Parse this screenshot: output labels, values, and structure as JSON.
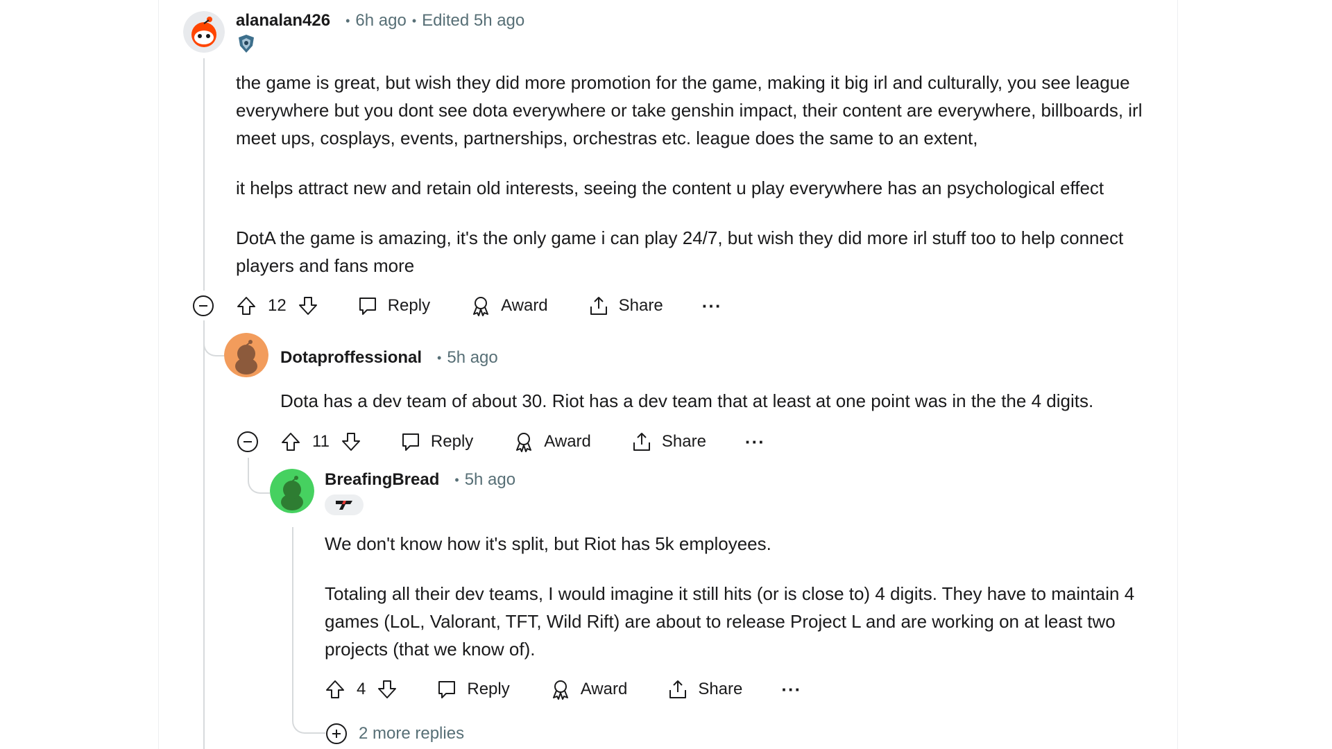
{
  "comments": [
    {
      "author": "alanalan426",
      "time": "6h ago",
      "edited": "Edited 5h ago",
      "avatar_color": "#ff4500",
      "paragraphs": [
        "the game is great, but wish they did more promotion for the game, making it big irl and culturally, you see league everywhere but you dont see dota everywhere or take genshin impact, their content are everywhere, billboards, irl meet ups, cosplays, events, partnerships, orchestras etc. league does the same to an extent,",
        "it helps attract new and retain old interests, seeing the content u play everywhere has an psychological effect",
        "DotA the game is amazing, it's the only game i can play 24/7, but wish they did more irl stuff too to help connect players and fans more"
      ],
      "score": "12",
      "reply_label": "Reply",
      "award_label": "Award",
      "share_label": "Share",
      "more_label": "···"
    },
    {
      "author": "Dotaproffessional",
      "time": "5h ago",
      "avatar_color": "#f29c5c",
      "paragraphs": [
        "Dota has a dev team of about 30. Riot has a dev team that at least at one point was in the the 4 digits."
      ],
      "score": "11",
      "reply_label": "Reply",
      "award_label": "Award",
      "share_label": "Share",
      "more_label": "···"
    },
    {
      "author": "BreafingBread",
      "time": "5h ago",
      "avatar_color": "#46d160",
      "paragraphs": [
        "We don't know how it's split, but Riot has 5k employees.",
        "Totaling all their dev teams, I would imagine it still hits (or is close to) 4 digits. They have to maintain 4 games (LoL, Valorant, TFT, Wild Rift) are about to release Project L and are working on at least two projects (that we know of)."
      ],
      "score": "4",
      "reply_label": "Reply",
      "award_label": "Award",
      "share_label": "Share",
      "more_label": "···"
    }
  ],
  "more_replies": "2 more replies",
  "icons": {
    "upvote": "upvote-arrow-icon",
    "downvote": "downvote-arrow-icon",
    "reply": "speech-bubble-icon",
    "award": "award-ribbon-icon",
    "share": "share-upload-icon",
    "collapse": "minus-circle-icon",
    "expand": "plus-circle-icon"
  }
}
